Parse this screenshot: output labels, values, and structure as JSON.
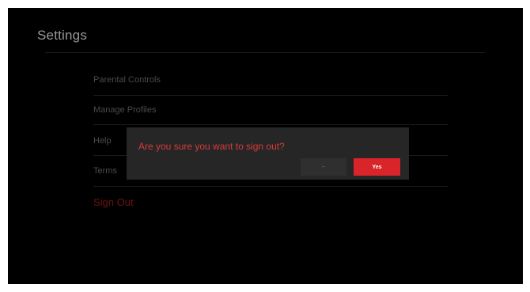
{
  "page": {
    "title": "Settings"
  },
  "menu": {
    "items": [
      {
        "label": "Parental Controls"
      },
      {
        "label": "Manage Profiles"
      },
      {
        "label": "Help"
      },
      {
        "label": "Terms"
      },
      {
        "label": "Sign Out"
      }
    ]
  },
  "dialog": {
    "message": "Are you sure you want to sign out?",
    "cancel_label": "--",
    "confirm_label": "Yes"
  },
  "colors": {
    "background": "#000000",
    "accent": "#d9242a",
    "dialog_background": "#262626"
  }
}
